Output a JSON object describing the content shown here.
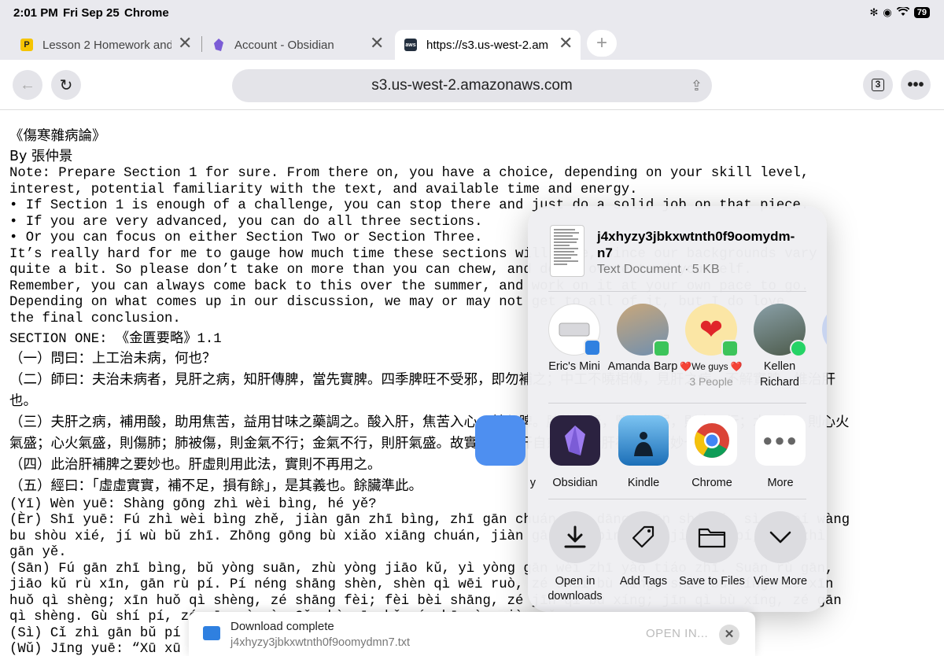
{
  "status": {
    "time": "2:01 PM",
    "date": "Fri Sep 25",
    "app": "Chrome",
    "battery": "79"
  },
  "tabs": [
    {
      "title": "Lesson 2 Homework and",
      "favicon": "P"
    },
    {
      "title": "Account - Obsidian",
      "favicon": "obsidian"
    },
    {
      "title": "https://s3.us-west-2.am",
      "favicon": "aws"
    }
  ],
  "toolbar": {
    "url": "s3.us-west-2.amazonaws.com",
    "tab_count": "3"
  },
  "page": {
    "lines": [
      "《傷寒雜病論》",
      "By 張仲景",
      "Note: Prepare Section 1 for sure. From there on, you have a choice, depending on your skill level,",
      "interest, potential familiarity with the text, and available time and energy.",
      "• If Section 1 is enough of a challenge, you can stop there and just do a solid job on that piece.",
      "• If you are very advanced, you can do all three sections.",
      "• Or you can focus on either Section Two or Section Three.",
      "It’s really hard for me to gauge how much time these sections will take, since our backgrounds vary",
      "quite a bit. So please don’t take on more than you can chew, and don’t overextend yourself.",
      "Remember, you can always come back to this over the summer, and work on it at your own pace to go.",
      "Depending on what comes up in our discussion, we may or may not get to all of it, but I do love",
      "the final conclusion.",
      "SECTION ONE: 《金匱要略》1.1",
      "（一）問曰：上工治未病，何也？",
      "（二）師曰：夫治未病者，見肝之病，知肝傳脾，當先實脾。四季脾旺不受邪，即勿補之；中工不曉相傳，見肝之病，不解實脾，惟治肝",
      "也。",
      "（三）夫肝之病，補用酸，助用焦苦，益用甘味之藥調之。酸入肝，焦苦入心，甘入脾。脾能傷腎，腎氣微弱，則水不行；水不行，則心火",
      "氣盛；心火氣盛，則傷肺；肺被傷，則金氣不行；金氣不行，則肝氣盛。故實脾，則肝自愈。此治肝補脾之要妙也。",
      "（四）此治肝補脾之要妙也。肝虛則用此法，實則不再用之。",
      "（五）經曰：「虛虛實實，補不足，損有餘」，是其義也。餘臟準此。",
      "(Yī) Wèn yuē: Shàng gōng zhì wèi bìng, hé yě?",
      "(Èr) Shī yuē: Fú zhì wèi bìng zhě, jiàn gān zhī bìng, zhī gān chuán pí, dāng xiān shí pí, sì jì pí wàng",
      "bu shòu xié, jí wù bǔ zhī. Zhōng gōng bù xiǎo xiāng chuán, jiàn gān zhī bìng, bù jiě shí pí, wéi zhì",
      "gān yě.",
      "(Sān) Fú gān zhī bìng, bǔ yòng suān, zhù yòng jiāo kǔ, yì yòng gān wèi zhī yào tiáo zhī. Suān rù gān,",
      "jiāo kǔ rù xīn, gān rù pí. Pí néng shāng shèn, shèn qì wēi ruò, zé shuǐ bù xíng; shuǐ bù xíng, zé xīn",
      "huǒ qì shèng; xīn huǒ qì shèng, zé shāng fèi; fèi bèi shāng, zé jīn qì bù xíng; jīn qì bù xíng, zé gān",
      "qì shèng. Gù shí pí, zé gān zì yù. Cǐ zhì gān bǔ pí zhī yào miào yě.",
      "(Sì) Cǐ zhì gān bǔ pí zhī yào miào yě. Gān xū zé yòng cǐ fǎ, shí zé bù zài yòng zhī.",
      "(Wǔ) Jīng yuē: “Xū xū shí shí, bǔ bù zú, sǔn yǒu yú,” shì qí yì yě. Yú zàng zhǔn cǐ."
    ]
  },
  "share": {
    "file_name": "j4xhyzy3jbkxwtnth0f9oomydm-n7",
    "file_meta": "Text Document · 5 KB",
    "people": [
      {
        "name": "Eric's Mini",
        "sub": ""
      },
      {
        "name": "Amanda Barp",
        "sub": ""
      },
      {
        "name": "❤️We guys ❤️",
        "sub": "3 People"
      },
      {
        "name": "Kellen Richard",
        "sub": ""
      }
    ],
    "apps": [
      {
        "name": "Obsidian"
      },
      {
        "name": "Kindle"
      },
      {
        "name": "Chrome"
      },
      {
        "name": "More"
      }
    ],
    "partial_app_label": "y",
    "actions": [
      {
        "name": "Open in downloads"
      },
      {
        "name": "Add Tags"
      },
      {
        "name": "Save to Files"
      },
      {
        "name": "View More"
      }
    ]
  },
  "download": {
    "title": "Download complete",
    "file": "j4xhyzy3jbkxwtnth0f9oomydmn7.txt",
    "open_label": "OPEN IN..."
  },
  "colors": {
    "chrome_bg": "#e9e9ee",
    "accent_blue": "#2f80e0",
    "obsidian_purple": "#7b5cd6"
  }
}
